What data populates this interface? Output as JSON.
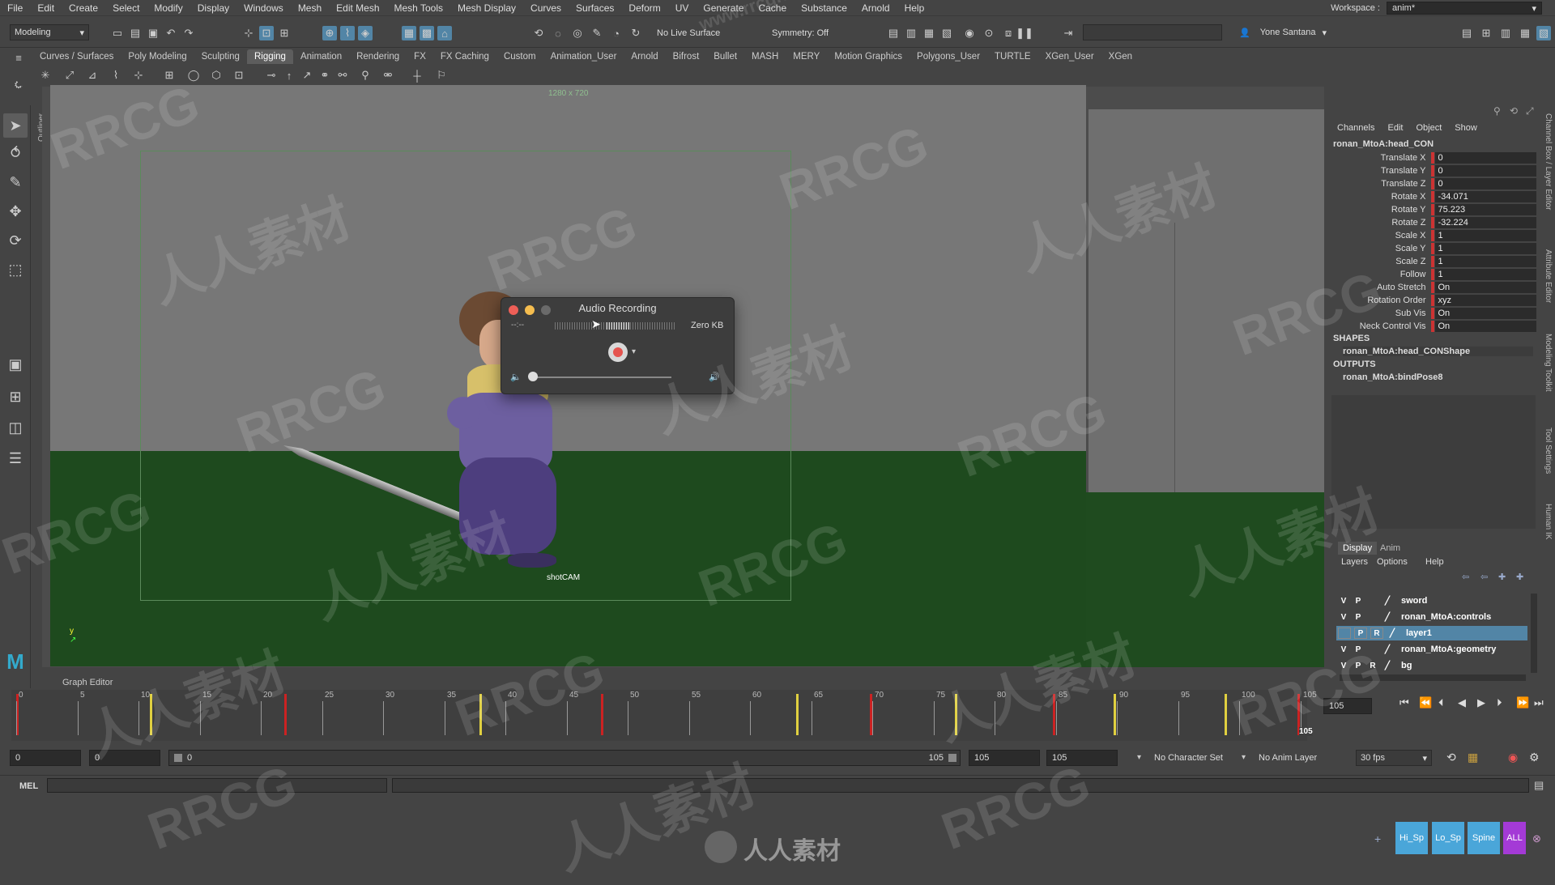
{
  "menubar": {
    "items": [
      "File",
      "Edit",
      "Create",
      "Select",
      "Modify",
      "Display",
      "Windows",
      "Mesh",
      "Edit Mesh",
      "Mesh Tools",
      "Mesh Display",
      "Curves",
      "Surfaces",
      "Deform",
      "UV",
      "Generate",
      "Cache",
      "Substance",
      "Arnold",
      "Help"
    ],
    "workspace_label": "Workspace :",
    "workspace_value": "anim*"
  },
  "statusline": {
    "mode_menu": "Modeling",
    "live_surface": "No Live Surface",
    "symmetry": "Symmetry: Off",
    "user_name": "Yone Santana"
  },
  "shelf": {
    "tabs": [
      "Curves / Surfaces",
      "Poly Modeling",
      "Sculpting",
      "Rigging",
      "Animation",
      "Rendering",
      "FX",
      "FX Caching",
      "Custom",
      "Animation_User",
      "Arnold",
      "Bifrost",
      "Bullet",
      "MASH",
      "MERY",
      "Motion Graphics",
      "Polygons_User",
      "TURTLE",
      "XGen_User",
      "XGen"
    ],
    "active_tab": "Rigging"
  },
  "viewport": {
    "resolution_label": "1280 x 720",
    "camera_name": "shotCAM",
    "outliner_tab": "Outliner"
  },
  "audio_dialog": {
    "title": "Audio Recording",
    "time": "--:--",
    "size": "Zero KB"
  },
  "channel_box": {
    "menu": [
      "Channels",
      "Edit",
      "Object",
      "Show"
    ],
    "node_name": "ronan_MtoA:head_CON",
    "attributes": [
      {
        "label": "Translate X",
        "value": "0"
      },
      {
        "label": "Translate Y",
        "value": "0"
      },
      {
        "label": "Translate Z",
        "value": "0"
      },
      {
        "label": "Rotate X",
        "value": "-34.071"
      },
      {
        "label": "Rotate Y",
        "value": "75.223"
      },
      {
        "label": "Rotate Z",
        "value": "-32.224"
      },
      {
        "label": "Scale X",
        "value": "1"
      },
      {
        "label": "Scale Y",
        "value": "1"
      },
      {
        "label": "Scale Z",
        "value": "1"
      },
      {
        "label": "Follow",
        "value": "1"
      },
      {
        "label": "Auto Stretch",
        "value": "On"
      },
      {
        "label": "Rotation Order",
        "value": "xyz"
      },
      {
        "label": "Sub Vis",
        "value": "On"
      },
      {
        "label": "Neck Control Vis",
        "value": "On"
      }
    ],
    "shapes_header": "SHAPES",
    "shapes_item": "ronan_MtoA:head_CONShape",
    "outputs_header": "OUTPUTS",
    "outputs_item": "ronan_MtoA:bindPose8"
  },
  "layer_editor": {
    "tabs": [
      "Display",
      "Anim"
    ],
    "menu": [
      "Layers",
      "Options",
      "Help"
    ],
    "layers": [
      {
        "v": "V",
        "p": "P",
        "r": "",
        "name": "sword"
      },
      {
        "v": "V",
        "p": "P",
        "r": "",
        "name": "ronan_MtoA:controls"
      },
      {
        "v": "",
        "p": "P",
        "r": "R",
        "name": "layer1"
      },
      {
        "v": "V",
        "p": "P",
        "r": "",
        "name": "ronan_MtoA:geometry"
      },
      {
        "v": "V",
        "p": "P",
        "r": "R",
        "name": "bg"
      }
    ]
  },
  "side_tabs": [
    "Channel Box / Layer Editor",
    "Attribute Editor",
    "Modeling Toolkit",
    "Tool Settings",
    "Human IK"
  ],
  "timeline": {
    "graph_editor_label": "Graph Editor",
    "tick_labels": [
      "0",
      "5",
      "10",
      "15",
      "20",
      "25",
      "30",
      "35",
      "40",
      "45",
      "50",
      "55",
      "60",
      "65",
      "70",
      "75",
      "80",
      "85",
      "90",
      "95",
      "100",
      "105"
    ],
    "current_frame": "105",
    "current_frame_marker": "105"
  },
  "range": {
    "start": "0",
    "playback_start": "0",
    "slider_start": "0",
    "slider_end": "105",
    "playback_end": "105",
    "end": "105",
    "character_set": "No Character Set",
    "anim_layer": "No Anim Layer",
    "fps": "30 fps"
  },
  "cmdline": {
    "label": "MEL"
  },
  "shelf_buttons": [
    "Hi_Sp",
    "Lo_Sp",
    "Spine",
    "ALL"
  ],
  "watermark": {
    "rrcg": "RRCG",
    "cn": "人人素材",
    "url": "www.rrcg.cn"
  },
  "bottom_brand": "人人素材"
}
